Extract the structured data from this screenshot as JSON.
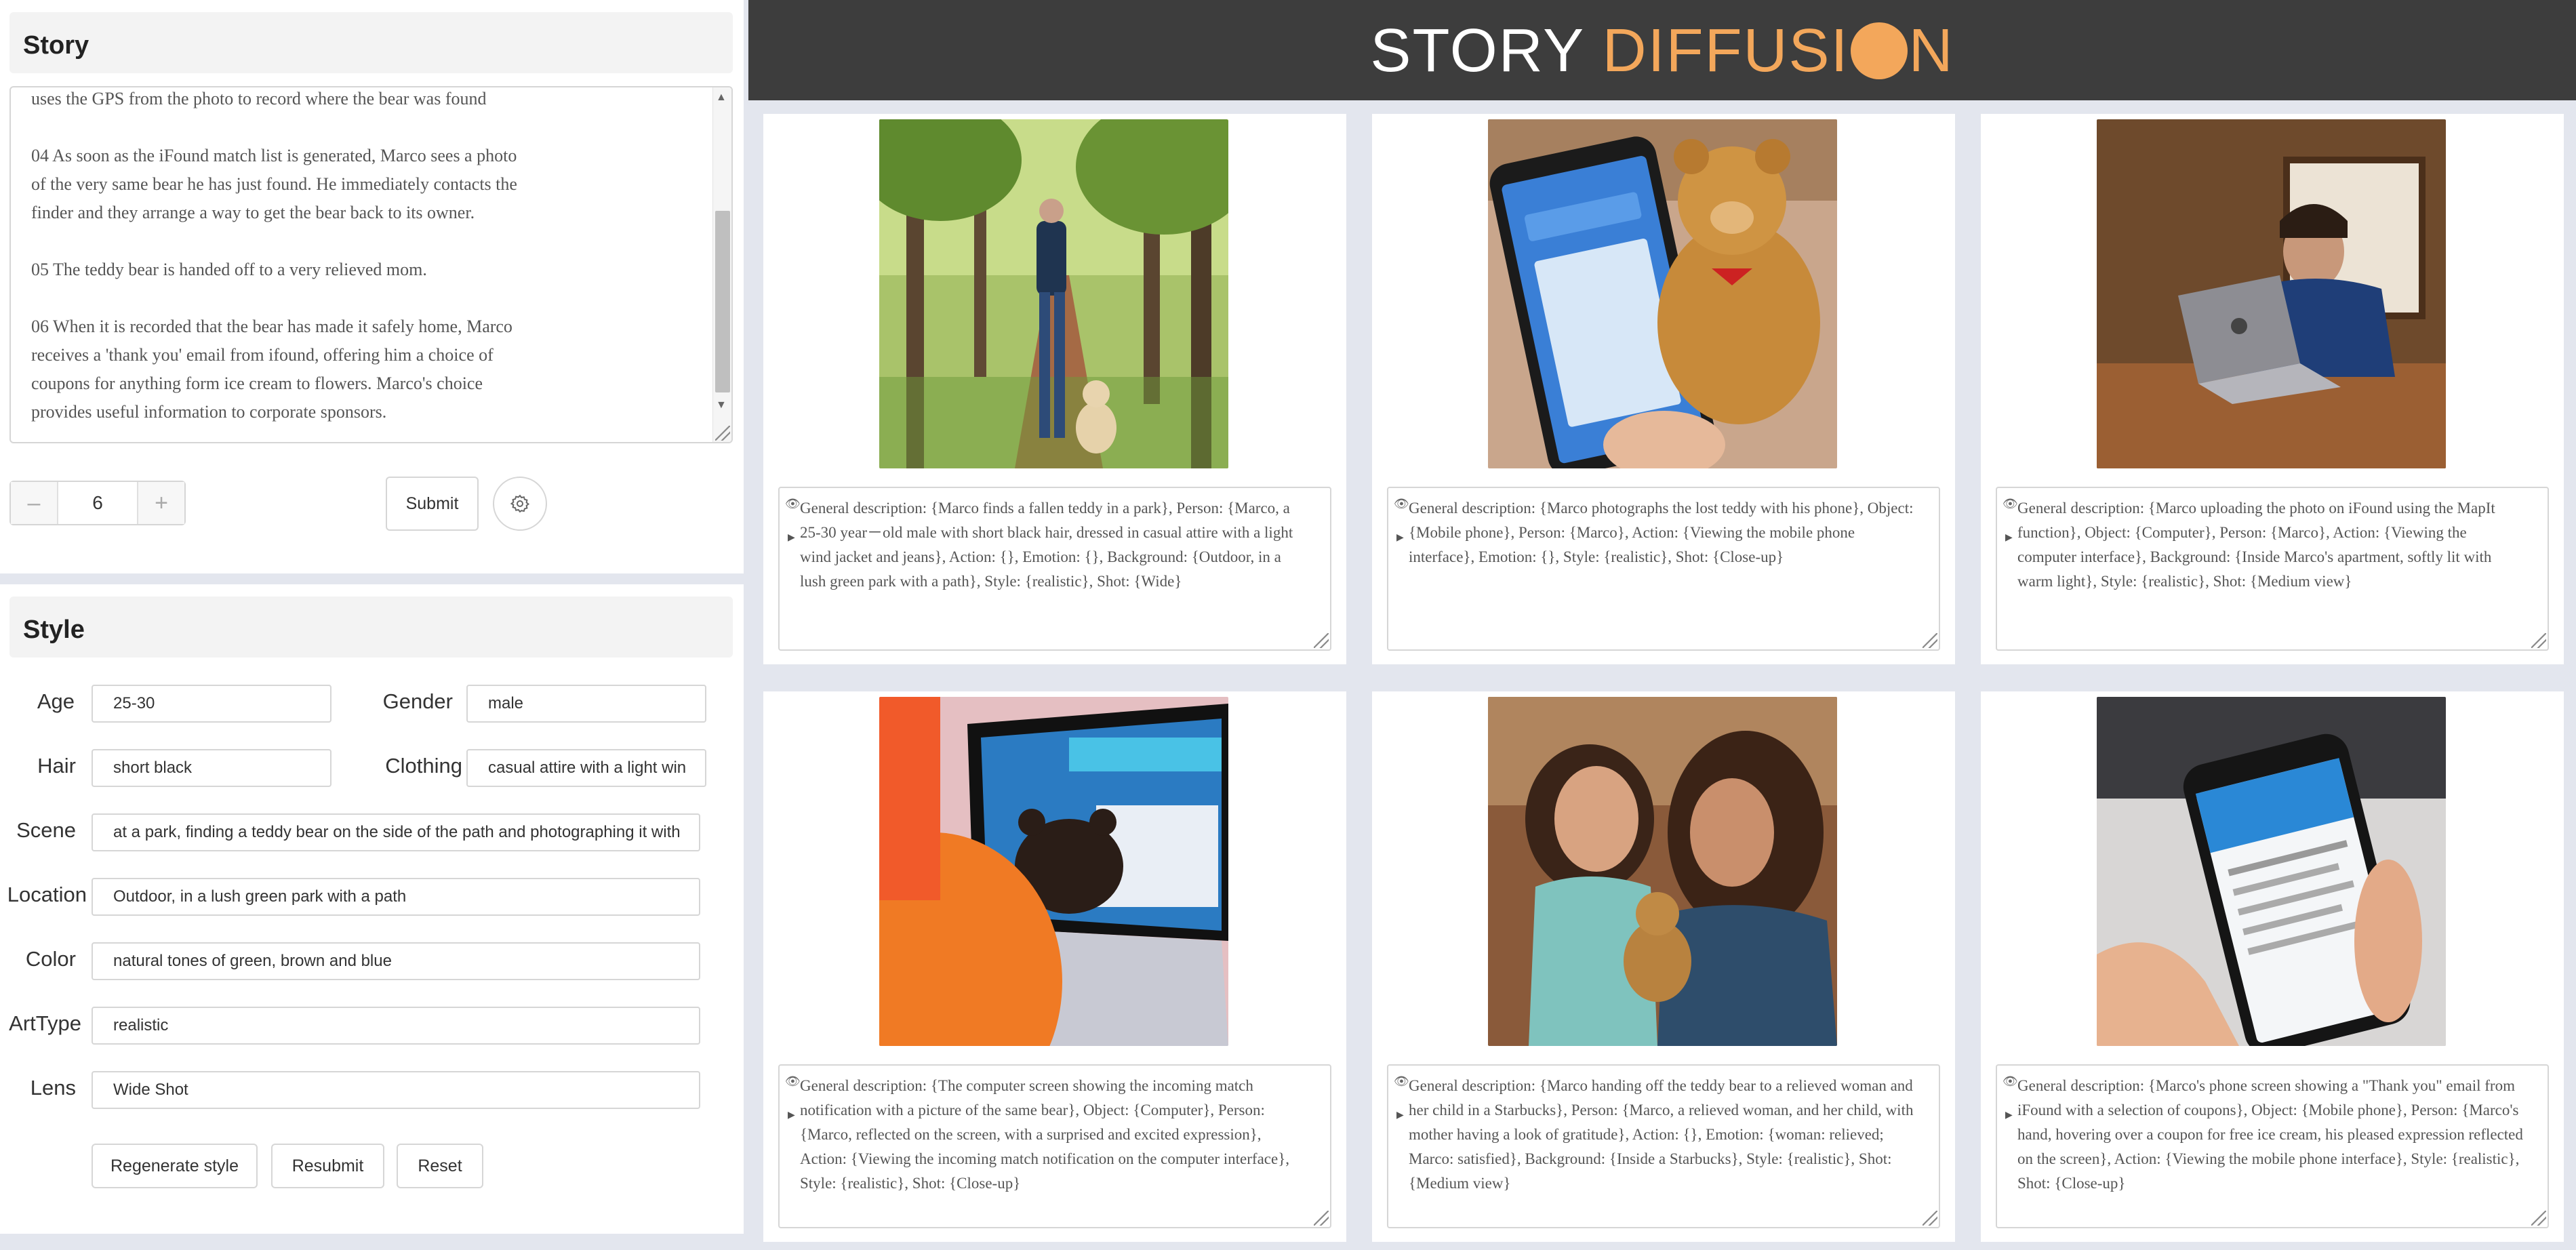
{
  "story": {
    "heading": "Story",
    "text": "uses the GPS from the photo to record where the bear was found\n\n04 As soon as the iFound match list is generated, Marco sees a photo\nof the very same bear he has just found. He immediately contacts the\nfinder and they arrange a way to get the bear back to its owner.\n\n05 The teddy bear is handed off to a very relieved mom.\n\n06 When it is recorded that the bear has made it safely home, Marco\nreceives a 'thank you' email from ifound, offering him a choice of\ncoupons for anything form ice cream to flowers. Marco's choice\nprovides useful information to corporate sponsors.",
    "stepper_value": "6",
    "minus": "–",
    "plus": "+",
    "submit_label": "Submit"
  },
  "style": {
    "heading": "Style",
    "age_label": "Age",
    "age_value": "25-30",
    "gender_label": "Gender",
    "gender_value": "male",
    "hair_label": "Hair",
    "hair_value": "short black",
    "clothing_label": "Clothing",
    "clothing_value": "casual attire with a light win",
    "scene_label": "Scene",
    "scene_value": "at a park, finding a teddy bear on the side of the path and photographing it with",
    "location_label": "Location",
    "location_value": "Outdoor, in a lush green park with a path",
    "color_label": "Color",
    "color_value": "natural tones of green, brown and blue",
    "arttype_label": "ArtType",
    "arttype_value": "realistic",
    "lens_label": "Lens",
    "lens_value": "Wide Shot",
    "regenerate_label": "Regenerate style",
    "resubmit_label": "Resubmit",
    "reset_label": "Reset"
  },
  "header": {
    "title_part1": "STORY ",
    "title_part2a": "DIFFUSI",
    "title_part2b": "N"
  },
  "gallery": [
    {
      "caption": "General description: {Marco finds a fallen teddy in a park}, Person: {Marco, a 25-30 year－old male with short black hair, dressed in casual attire with a light wind jacket and jeans}, Action: {}, Emotion: {}, Background: {Outdoor, in a lush green park with a path}, Style: {realistic}, Shot: {Wide}"
    },
    {
      "caption": "General description: {Marco photographs the lost teddy with his phone}, Object: {Mobile phone}, Person: {Marco}, Action: {Viewing the mobile phone interface}, Emotion: {}, Style: {realistic}, Shot: {Close-up}"
    },
    {
      "caption": "General description: {Marco uploading the photo on iFound using the MapIt function}, Object: {Computer}, Person: {Marco}, Action: {Viewing the computer interface}, Background: {Inside Marco's apartment, softly lit with warm light}, Style: {realistic}, Shot: {Medium view}"
    },
    {
      "caption": "General description: {The computer screen showing the incoming match notification with a picture of the same bear}, Object: {Computer}, Person: {Marco, reflected on the screen, with a surprised and excited expression}, Action: {Viewing the incoming match notification on the computer interface}, Style: {realistic}, Shot: {Close-up}"
    },
    {
      "caption": "General description: {Marco handing off the teddy bear to a relieved woman and her child in a Starbucks}, Person: {Marco, a relieved woman, and her child, with mother having a look of gratitude}, Action: {}, Emotion: {woman: relieved; Marco: satisfied}, Background: {Inside a Starbucks}, Style: {realistic}, Shot: {Medium view}"
    },
    {
      "caption": "General description: {Marco's phone screen showing a \"Thank you\" email from iFound with a selection of coupons}, Object: {Mobile phone}, Person: {Marco's hand, hovering over a coupon for free ice cream, his pleased expression reflected on the screen}, Action: {Viewing the mobile phone interface}, Style: {realistic}, Shot: {Close-up}"
    }
  ]
}
